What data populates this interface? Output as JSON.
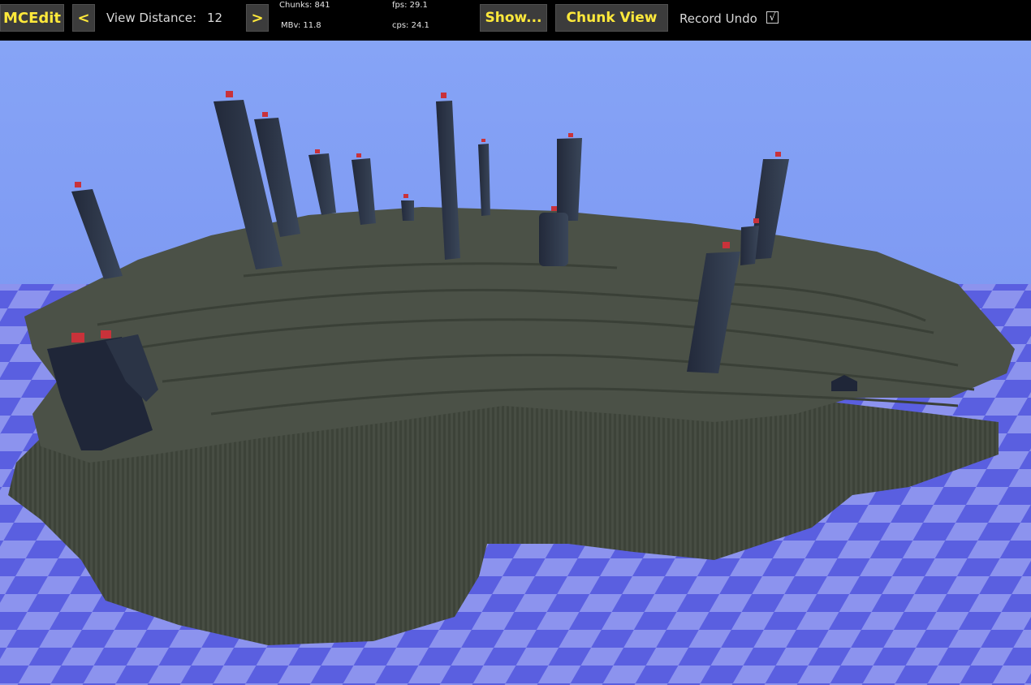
{
  "toolbar": {
    "app_title": "MCEdit",
    "view_distance_prev_label": "<",
    "view_distance_label": "View Distance:",
    "view_distance_value": "12",
    "view_distance_next_label": ">",
    "stats": {
      "chunks": "Chunks: 841",
      "mbv": "MBv: 11.8",
      "fps": "fps: 29.1",
      "cps": "cps: 24.1"
    },
    "show_label": "Show...",
    "chunk_view_label": "Chunk View",
    "record_undo_label": "Record Undo",
    "record_undo_checked": true,
    "checkmark_glyph": "√"
  },
  "colors": {
    "toolbar_bg": "#000000",
    "button_bg": "#3c3c3c",
    "button_text": "#ffe93b",
    "sky_top": "#86a4f6",
    "sky_bottom": "#6d86e6",
    "grid_dark": "#5a5fe0",
    "grid_light": "#8c93ee",
    "terrain": "#4b5147",
    "terrain_dark": "#3a4037",
    "pillar": "#2b3446",
    "crystal": "#c9323a"
  }
}
